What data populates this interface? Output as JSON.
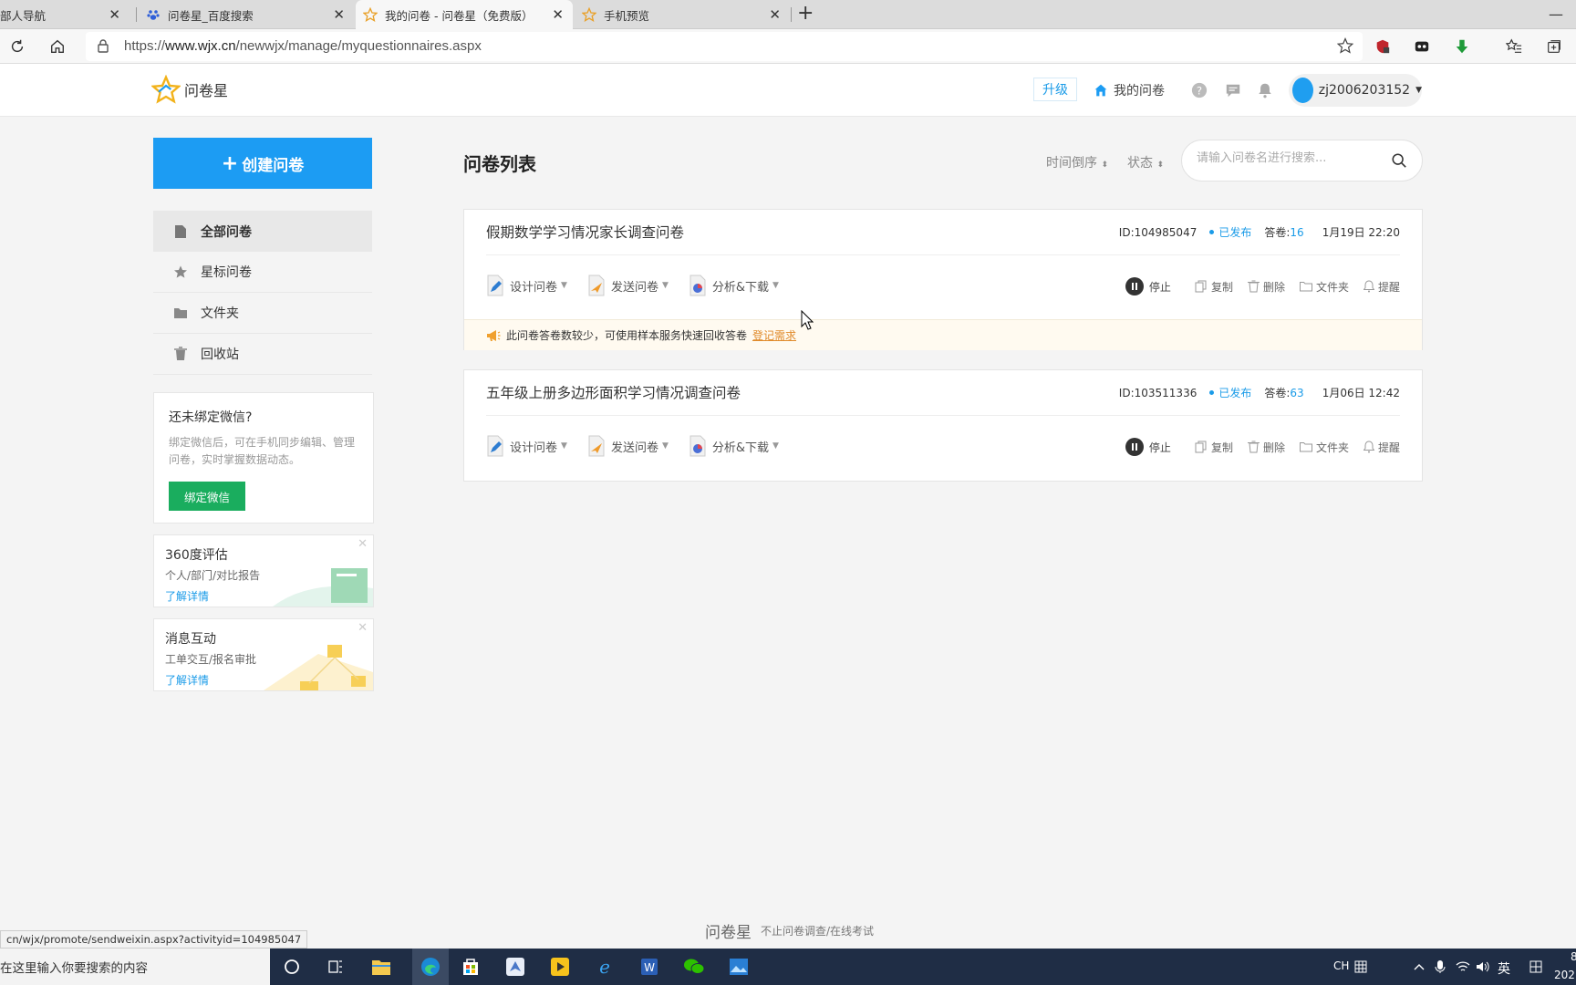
{
  "browser": {
    "tabs": [
      {
        "label": "部人导航"
      },
      {
        "label": "问卷星_百度搜索"
      },
      {
        "label": "我的问卷 - 问卷星（免费版）"
      },
      {
        "label": "手机预览"
      }
    ],
    "url_prefix": "https://",
    "url_domain": "www.wjx.cn",
    "url_path": "/newwjx/manage/myquestionnaires.aspx"
  },
  "header": {
    "logo_text": "问卷星",
    "upgrade_label": "升级",
    "my_questionnaires_label": "我的问卷",
    "username": "zj2006203152"
  },
  "sidebar": {
    "create_label": "创建问卷",
    "items": [
      {
        "label": "全部问卷"
      },
      {
        "label": "星标问卷"
      },
      {
        "label": "文件夹"
      },
      {
        "label": "回收站"
      }
    ],
    "wechat": {
      "title": "还未绑定微信?",
      "desc": "绑定微信后，可在手机同步编辑、管理问卷，实时掌握数据动态。",
      "button": "绑定微信"
    },
    "promos": [
      {
        "title": "360度评估",
        "subtitle": "个人/部门/对比报告",
        "link": "了解详情"
      },
      {
        "title": "消息互动",
        "subtitle": "工单交互/报名审批",
        "link": "了解详情"
      }
    ]
  },
  "main": {
    "title": "问卷列表",
    "sort_time": "时间倒序",
    "sort_status": "状态",
    "search_placeholder": "请输入问卷名进行搜索...",
    "questionnaires": [
      {
        "title": "假期数学学习情况家长调查问卷",
        "id": "ID:104985047",
        "status": "已发布",
        "answers_label": "答卷:",
        "answers": "16",
        "time": "1月19日 22:20",
        "notice": "此问卷答卷数较少，可使用样本服务快速回收答卷",
        "notice_link": "登记需求"
      },
      {
        "title": "五年级上册多边形面积学习情况调查问卷",
        "id": "ID:103511336",
        "status": "已发布",
        "answers_label": "答卷:",
        "answers": "63",
        "time": "1月06日 12:42"
      }
    ],
    "actions": {
      "design": "设计问卷",
      "send": "发送问卷",
      "analyze": "分析&下载"
    },
    "ops": {
      "stop": "停止",
      "copy": "复制",
      "delete": "删除",
      "folder": "文件夹",
      "remind": "提醒"
    }
  },
  "footer": {
    "logo": "问卷星",
    "slogan": "不止问卷调查/在线考试"
  },
  "status_url": "cn/wjx/promote/sendweixin.aspx?activityid=104985047",
  "taskbar": {
    "search_text": "在这里输入你要搜索的内容",
    "ime_ch": "CH",
    "ime_lang": "英",
    "clock_line1": "8",
    "clock_line2": "202"
  },
  "colors": {
    "primary": "#1c9cf3",
    "wechat_green": "#1aad5e",
    "notice_orange": "#e08a2a"
  }
}
